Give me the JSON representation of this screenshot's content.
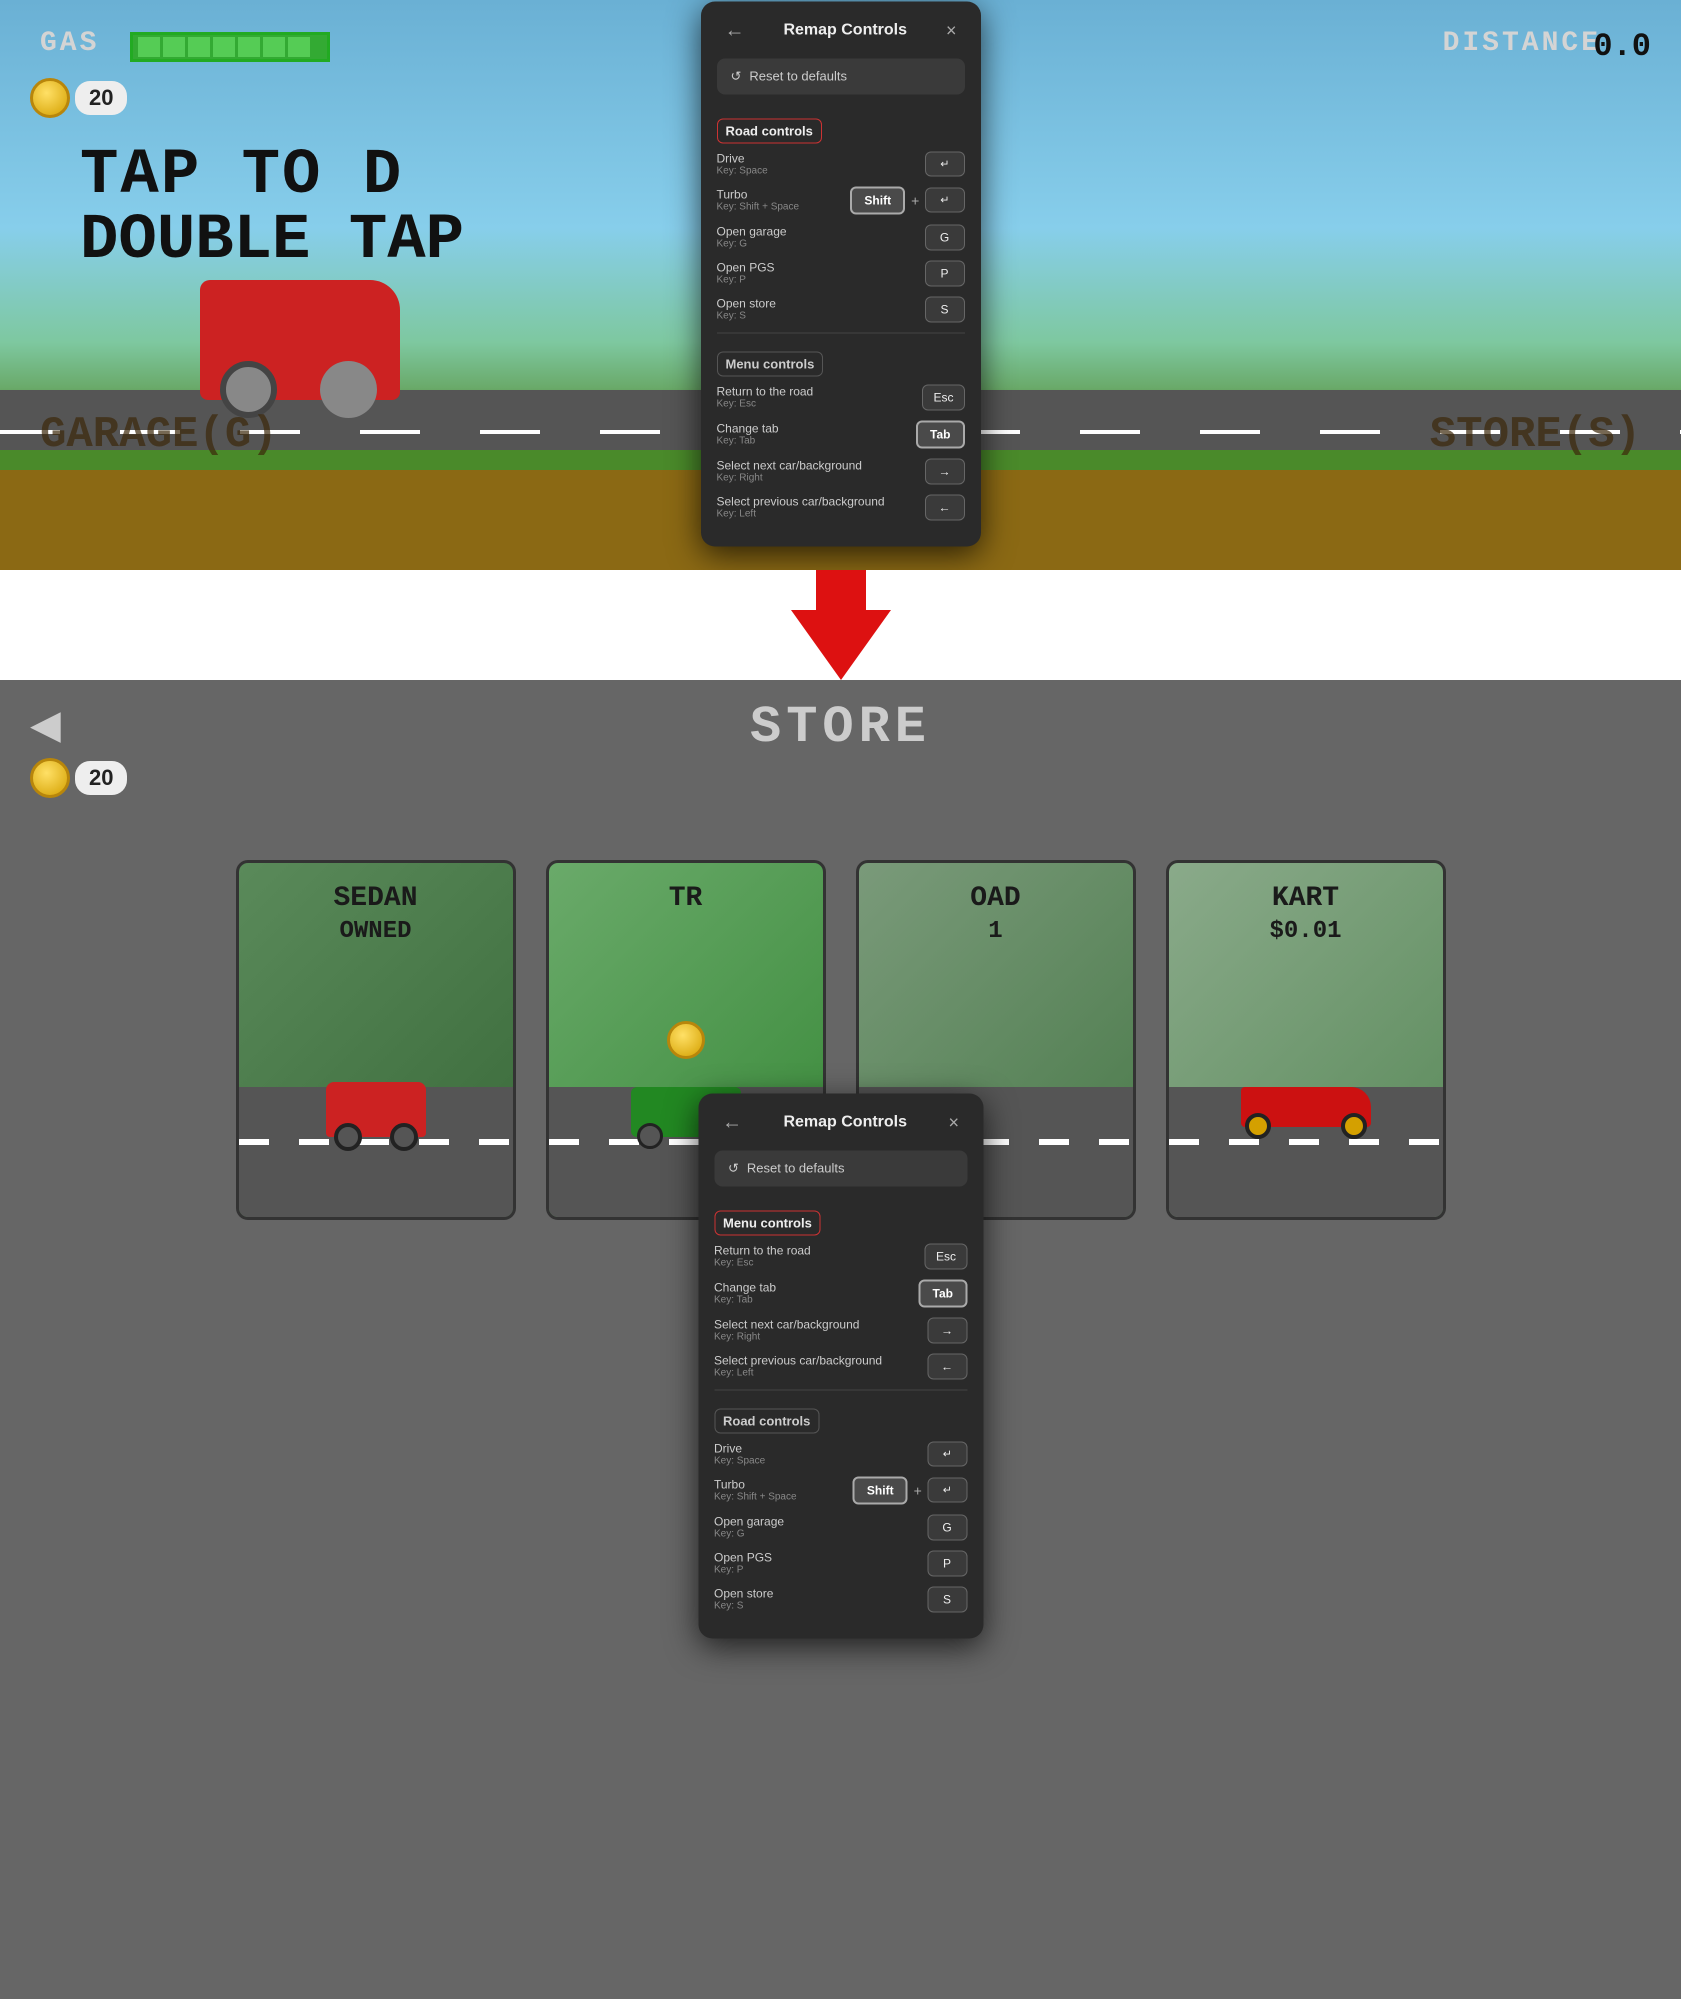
{
  "top": {
    "gas_label": "GAS",
    "distance_label": "DISTANCE",
    "distance_value": "0.0",
    "coin_value": "20",
    "tap_text": "TAP TO D",
    "double_tap_text": "DOUBLE TAP",
    "garage_label": "GARAGE(G)",
    "store_label": "STORE(S)",
    "gas_segments": 7
  },
  "bottom": {
    "store_title": "STORE",
    "coin_value": "20",
    "cars": [
      {
        "label": "SEDAN",
        "sub": "OWNED",
        "price": null
      },
      {
        "label": "TR",
        "sub": null,
        "price": null
      },
      {
        "label": "OAD",
        "sub": "1",
        "price": null
      },
      {
        "label": "KART",
        "sub": "$0.01",
        "price": "0.01"
      }
    ]
  },
  "modal_top": {
    "title": "Remap Controls",
    "back_label": "←",
    "close_label": "×",
    "reset_label": "Reset to defaults",
    "road_controls_header": "Road controls",
    "road_controls": [
      {
        "action": "Drive",
        "subkey": "Key: Space",
        "keys": [
          "↵"
        ]
      },
      {
        "action": "Turbo",
        "subkey": "Key: Shift + Space",
        "keys": [
          "Shift",
          "↵"
        ]
      },
      {
        "action": "Open garage",
        "subkey": "Key: G",
        "keys": [
          "G"
        ]
      },
      {
        "action": "Open PGS",
        "subkey": "Key: P",
        "keys": [
          "P"
        ]
      },
      {
        "action": "Open store",
        "subkey": "Key: S",
        "keys": [
          "S"
        ]
      }
    ],
    "menu_controls_header": "Menu controls",
    "menu_controls": [
      {
        "action": "Return to the road",
        "subkey": "Key: Esc",
        "keys": [
          "Esc"
        ]
      },
      {
        "action": "Change tab",
        "subkey": "Key: Tab",
        "keys": [
          "Tab"
        ]
      },
      {
        "action": "Select next car/background",
        "subkey": "Key: Right",
        "keys": [
          "→"
        ]
      },
      {
        "action": "Select previous car/background",
        "subkey": "Key: Left",
        "keys": [
          "←"
        ]
      }
    ]
  },
  "modal_bottom": {
    "title": "Remap Controls",
    "back_label": "←",
    "close_label": "×",
    "reset_label": "Reset to defaults",
    "menu_controls_header": "Menu controls",
    "menu_controls": [
      {
        "action": "Return to the road",
        "subkey": "Key: Esc",
        "keys": [
          "Esc"
        ]
      },
      {
        "action": "Change tab",
        "subkey": "Key: Tab",
        "keys": [
          "Tab"
        ]
      },
      {
        "action": "Select next car/background",
        "subkey": "Key: Right",
        "keys": [
          "→"
        ]
      },
      {
        "action": "Select previous car/background",
        "subkey": "Key: Left",
        "keys": [
          "←"
        ]
      }
    ],
    "road_controls_header": "Road controls",
    "road_controls": [
      {
        "action": "Drive",
        "subkey": "Key: Space",
        "keys": [
          "↵"
        ]
      },
      {
        "action": "Turbo",
        "subkey": "Key: Shift + Space",
        "keys": [
          "Shift",
          "↵"
        ]
      },
      {
        "action": "Open garage",
        "subkey": "Key: G",
        "keys": [
          "G"
        ]
      },
      {
        "action": "Open PGS",
        "subkey": "Key: P",
        "keys": [
          "P"
        ]
      },
      {
        "action": "Open store",
        "subkey": "Key: S",
        "keys": [
          "S"
        ]
      }
    ]
  },
  "arrow": {
    "direction": "down"
  }
}
